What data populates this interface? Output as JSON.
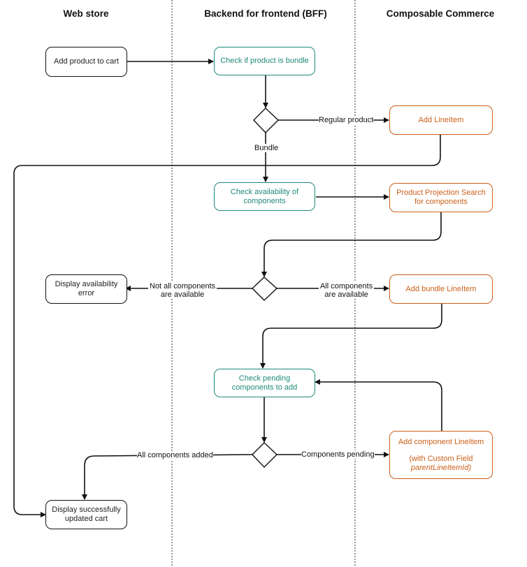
{
  "lanes": [
    {
      "title": "Web store"
    },
    {
      "title": "Backend for frontend (BFF)"
    },
    {
      "title": "Composable Commerce"
    }
  ],
  "colors": {
    "bff": "#1f8a7a",
    "cc": "#cc5f1a",
    "neutral": "#111111"
  },
  "nodes": {
    "add_product": "Add product to cart",
    "check_bundle": "Check if product is bundle",
    "add_lineitem": "Add LineItem",
    "check_availability": "Check availability of components",
    "product_projection": "Product Projection Search for components",
    "availability_error": "Display availability error",
    "add_bundle_lineitem": "Add bundle LineItem",
    "check_pending": "Check pending components to add",
    "add_component_lineitem": "Add component LineItem",
    "add_component_note": "(with Custom Field",
    "add_component_field": "parentLineItemId)",
    "display_success": "Display successfully updated cart"
  },
  "edge_labels": {
    "regular_product": "Regular product",
    "bundle": "Bundle",
    "not_all_available_1": "Not all components",
    "not_all_available_2": "are available",
    "all_available_1": "All components",
    "all_available_2": "are available",
    "all_added": "All components added",
    "components_pending": "Components pending"
  }
}
